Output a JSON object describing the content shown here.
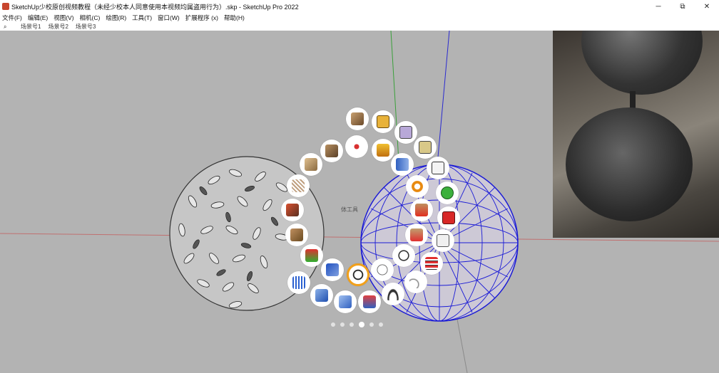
{
  "window": {
    "title": "SketchUp少校原创视频教程（未经少校本人同意使用本视频均属盗用行为）.skp - SketchUp Pro 2022",
    "minimize": "─",
    "maximize": "⧉",
    "close": "✕"
  },
  "menu": {
    "items": [
      "文件(F)",
      "编辑(E)",
      "视图(V)",
      "相机(C)",
      "绘图(R)",
      "工具(T)",
      "窗口(W)",
      "扩展程序 (x)",
      "帮助(H)"
    ]
  },
  "scenes": {
    "search_icon": "search-icon",
    "tabs": [
      "场景号1",
      "场景号2",
      "场景号3"
    ]
  },
  "viewport": {
    "hint_text": "体工具"
  },
  "tool_wheel": {
    "selected_tool": "tool-13",
    "page_count": 6,
    "active_page": 4,
    "colors": {
      "selection_ring": "#f2a01a",
      "mesh_blue": "#1a1ad6"
    }
  }
}
